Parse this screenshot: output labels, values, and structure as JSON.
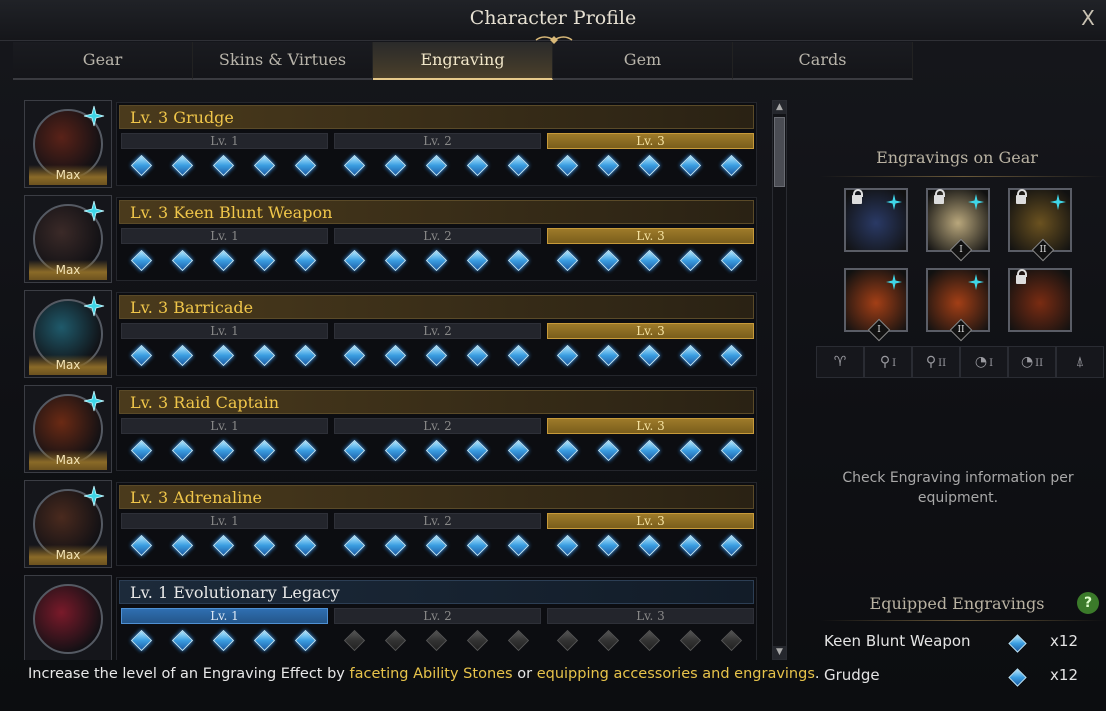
{
  "window": {
    "title": "Character Profile",
    "close_label": "X"
  },
  "tabs": [
    {
      "label": "Gear",
      "active": false
    },
    {
      "label": "Skins & Virtues",
      "active": false
    },
    {
      "label": "Engraving",
      "active": true
    },
    {
      "label": "Gem",
      "active": false
    },
    {
      "label": "Cards",
      "active": false
    }
  ],
  "engravings": [
    {
      "name": "Lv. 3 Grudge",
      "badge": "Max",
      "level_labels": [
        "Lv. 1",
        "Lv. 2",
        "Lv. 3"
      ],
      "active_level": 3,
      "filled_nodes": 15,
      "style": "gold"
    },
    {
      "name": "Lv. 3 Keen Blunt Weapon",
      "badge": "Max",
      "level_labels": [
        "Lv. 1",
        "Lv. 2",
        "Lv. 3"
      ],
      "active_level": 3,
      "filled_nodes": 15,
      "style": "gold"
    },
    {
      "name": "Lv. 3 Barricade",
      "badge": "Max",
      "level_labels": [
        "Lv. 1",
        "Lv. 2",
        "Lv. 3"
      ],
      "active_level": 3,
      "filled_nodes": 15,
      "style": "gold"
    },
    {
      "name": "Lv. 3 Raid Captain",
      "badge": "Max",
      "level_labels": [
        "Lv. 1",
        "Lv. 2",
        "Lv. 3"
      ],
      "active_level": 3,
      "filled_nodes": 15,
      "style": "gold"
    },
    {
      "name": "Lv. 3 Adrenaline",
      "badge": "Max",
      "level_labels": [
        "Lv. 1",
        "Lv. 2",
        "Lv. 3"
      ],
      "active_level": 3,
      "filled_nodes": 15,
      "style": "gold"
    },
    {
      "name": "Lv. 1 Evolutionary Legacy",
      "badge": "",
      "level_labels": [
        "Lv. 1",
        "Lv. 2",
        "Lv. 3"
      ],
      "active_level": 1,
      "filled_nodes": 5,
      "style": "blue"
    }
  ],
  "right_panel": {
    "gear_title": "Engravings on Gear",
    "equipment": [
      {
        "icon": "necklace-icon",
        "roman": "",
        "locked": true,
        "gem": true,
        "bg": "#2a3a66"
      },
      {
        "icon": "earring-icon",
        "roman": "I",
        "locked": true,
        "gem": true,
        "bg": "#b9a77c"
      },
      {
        "icon": "earring-icon",
        "roman": "II",
        "locked": true,
        "gem": true,
        "bg": "#6b5220"
      },
      {
        "icon": "ring-icon",
        "roman": "I",
        "locked": false,
        "gem": true,
        "bg": "#a33f16"
      },
      {
        "icon": "ring-icon",
        "roman": "II",
        "locked": false,
        "gem": true,
        "bg": "#a33f16"
      },
      {
        "icon": "ability-stone-icon",
        "roman": "",
        "locked": true,
        "gem": false,
        "bg": "#7a2c12"
      }
    ],
    "slot_icons": [
      {
        "icon": "necklace-slot-icon",
        "roman": ""
      },
      {
        "icon": "earring-slot-icon",
        "roman": "I"
      },
      {
        "icon": "earring-slot-icon",
        "roman": "II"
      },
      {
        "icon": "ring-slot-icon",
        "roman": "I"
      },
      {
        "icon": "ring-slot-icon",
        "roman": "II"
      },
      {
        "icon": "ability-stone-slot-icon",
        "roman": ""
      }
    ],
    "info_text": "Check Engraving information per equipment.",
    "equipped_title": "Equipped Engravings",
    "help_label": "?",
    "equipped": [
      {
        "name": "Keen Blunt Weapon",
        "count": "x12"
      },
      {
        "name": "Grudge",
        "count": "x12"
      }
    ]
  },
  "hint": {
    "prefix": "Increase the level of an Engraving Effect by ",
    "link1": "faceting Ability Stones",
    "middle": " or ",
    "link2": "equipping accessories and engravings",
    "suffix": "."
  },
  "colors": {
    "accent_gold": "#f0c64a",
    "node_blue": "#3a9de0",
    "help_green": "#3b7a2a"
  }
}
